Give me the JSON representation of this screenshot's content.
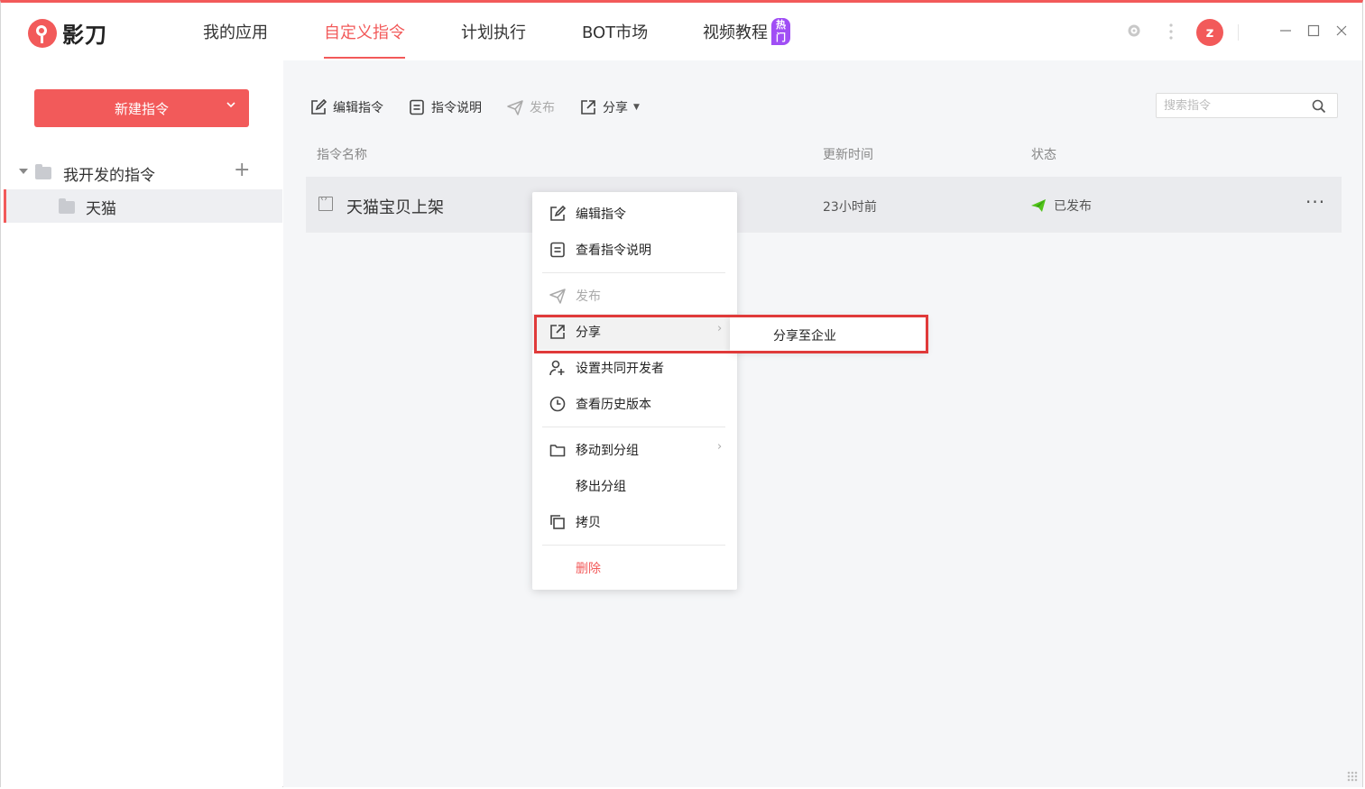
{
  "app": {
    "logo_text": "影刀"
  },
  "nav": {
    "items": [
      {
        "label": "我的应用"
      },
      {
        "label": "自定义指令"
      },
      {
        "label": "计划执行"
      },
      {
        "label": "BOT市场"
      },
      {
        "label": "视频教程",
        "badge": "热门"
      }
    ],
    "active_index": 1
  },
  "header": {
    "avatar_letter": "z",
    "icons": [
      "gear-icon",
      "more-vertical-icon",
      "minimize-icon",
      "maximize-icon",
      "close-icon"
    ]
  },
  "sidebar": {
    "new_button_label": "新建指令",
    "group_label": "我开发的指令",
    "items": [
      {
        "label": "天猫"
      }
    ]
  },
  "toolbar": {
    "edit": "编辑指令",
    "doc": "指令说明",
    "publish": "发布",
    "share": "分享"
  },
  "search": {
    "placeholder": "搜索指令"
  },
  "table": {
    "columns": [
      "指令名称",
      "更新时间",
      "状态"
    ],
    "rows": [
      {
        "name": "天猫宝贝上架",
        "updated": "23小时前",
        "status": "已发布"
      }
    ]
  },
  "context_menu": {
    "edit": "编辑指令",
    "view_doc": "查看指令说明",
    "publish": "发布",
    "share": "分享",
    "co_dev": "设置共同开发者",
    "history": "查看历史版本",
    "move_group": "移动到分组",
    "remove_group": "移出分组",
    "copy": "拷贝",
    "delete": "删除"
  },
  "submenu": {
    "share_enterprise": "分享至企业"
  },
  "colors": {
    "brand": "#f25a5a",
    "badge": "#a04ef5",
    "published": "#52c41a",
    "highlight": "#e03a3a"
  }
}
